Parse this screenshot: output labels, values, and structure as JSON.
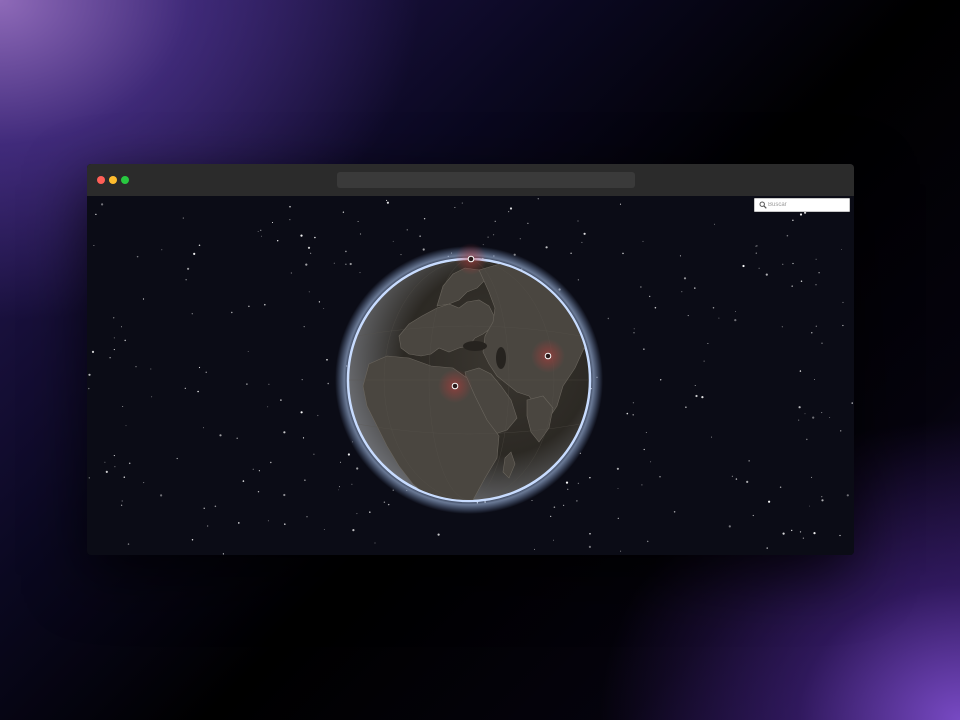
{
  "window": {
    "url": "",
    "traffic_lights": [
      {
        "name": "close",
        "color": "#ff5f57"
      },
      {
        "name": "minimize",
        "color": "#febc2e"
      },
      {
        "name": "maximize",
        "color": "#28c840"
      }
    ]
  },
  "search": {
    "placeholder": "Buscar",
    "icon": "search-icon"
  },
  "globe": {
    "style": "dark",
    "atmosphere_color": "#9fc3ff",
    "land_color": "#4a4640",
    "ocean_color": "#26231f"
  },
  "markers": [
    {
      "name": "marker-north"
    },
    {
      "name": "marker-east"
    },
    {
      "name": "marker-mediterranean"
    }
  ],
  "marker_color": "#c03a3a"
}
